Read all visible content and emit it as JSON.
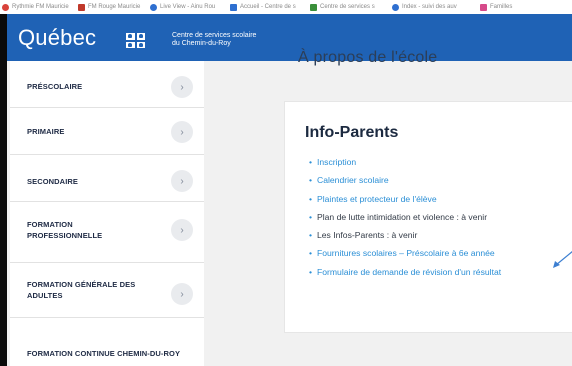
{
  "bookmarks": [
    {
      "label": "Rythmie FM Mauricie",
      "color": "#d9433a"
    },
    {
      "label": "FM Rouge Mauricie",
      "color": "#c0392b"
    },
    {
      "label": "Live View - Ainu Rou",
      "color": "#2e6fd0"
    },
    {
      "label": "Accueil - Centre de s",
      "color": "#2e6fd0"
    },
    {
      "label": "Centre de services s",
      "color": "#3a8f3a"
    },
    {
      "label": "Index - suivi des auv",
      "color": "#2e6fd0"
    },
    {
      "label": "Familles",
      "color": "#d64a8a"
    }
  ],
  "header": {
    "logo_text": "Québec",
    "org_line1": "Centre de services scolaire",
    "org_line2": "du Chemin-du-Roy",
    "bg_color": "#1f62b5"
  },
  "sidebar": {
    "items": [
      {
        "label": "PRÉSCOLAIRE"
      },
      {
        "label": "PRIMAIRE"
      },
      {
        "label": "SECONDAIRE"
      },
      {
        "label": "FORMATION PROFESSIONNELLE"
      },
      {
        "label": "FORMATION GÉNÉRALE DES ADULTES"
      },
      {
        "label": "FORMATION CONTINUE CHEMIN-DU-ROY"
      }
    ],
    "chevron_glyph": "›"
  },
  "main": {
    "partial_heading": "À propos de l'école",
    "card_title": "Info-Parents",
    "links": [
      {
        "label": "Inscription",
        "is_link": true
      },
      {
        "label": "Calendrier scolaire",
        "is_link": true
      },
      {
        "label": "Plaintes et protecteur de l'élève",
        "is_link": true
      },
      {
        "label": "Plan de lutte intimidation et violence : à venir",
        "is_link": false
      },
      {
        "label": "Les Infos-Parents : à venir",
        "is_link": false
      },
      {
        "label": "Fournitures scolaires – Préscolaire à 6e année",
        "is_link": true
      },
      {
        "label": "Formulaire de demande de révision d'un résultat",
        "is_link": true
      }
    ],
    "link_color": "#2b8fd6",
    "annotation_arrow_color": "#3d7fd1"
  }
}
